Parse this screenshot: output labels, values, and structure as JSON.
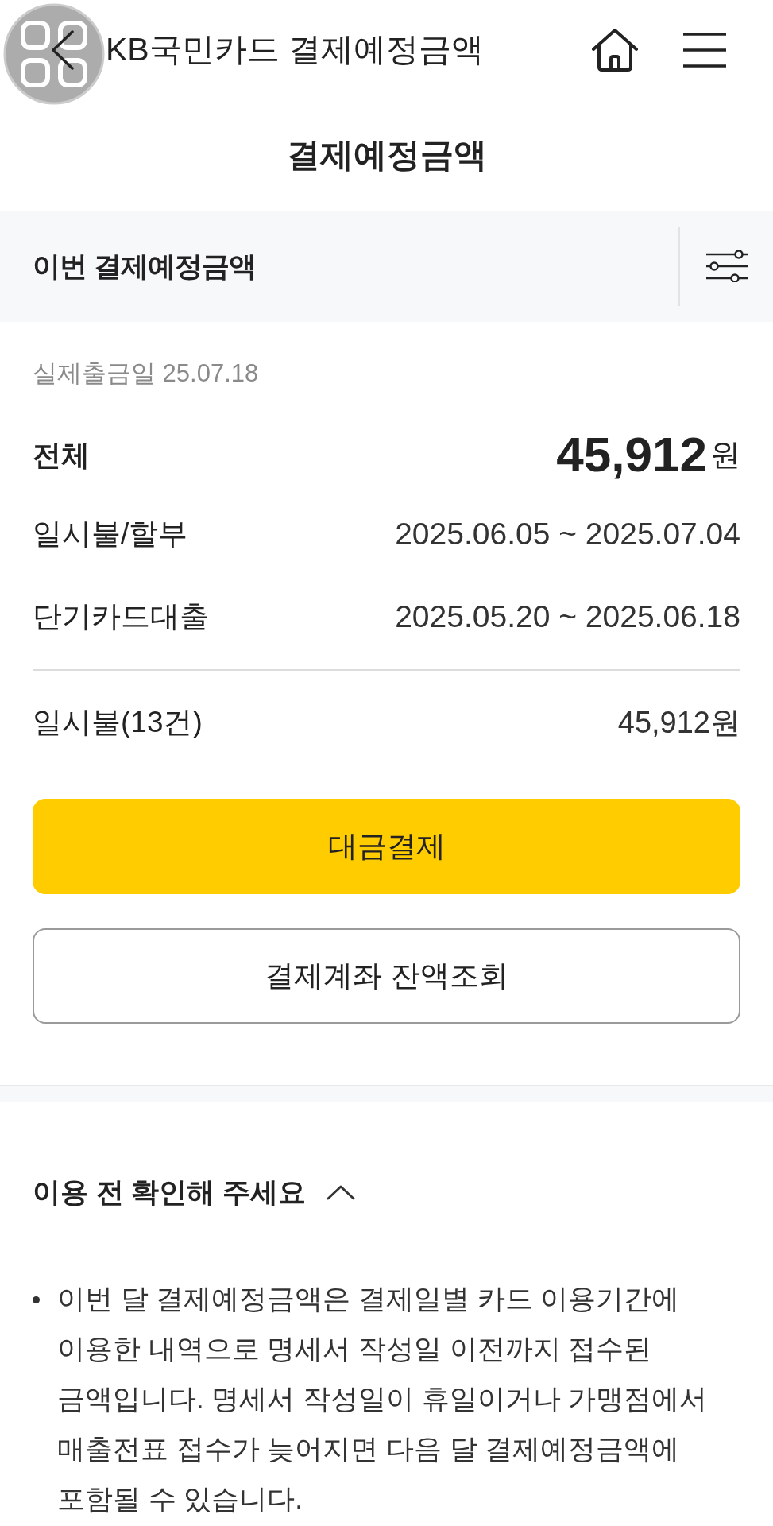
{
  "header": {
    "title": "KB국민카드 결제예정금액"
  },
  "page_title": "결제예정금액",
  "summary_header": {
    "title": "이번 결제예정금액"
  },
  "withdrawal_date": "실제출금일 25.07.18",
  "total": {
    "label": "전체",
    "amount": "45,912",
    "unit": "원"
  },
  "periods": [
    {
      "label": "일시불/할부",
      "value": "2025.06.05 ~ 2025.07.04"
    },
    {
      "label": "단기카드대출",
      "value": "2025.05.20 ~ 2025.06.18"
    }
  ],
  "breakdown": [
    {
      "label": "일시불(13건)",
      "amount": "45,912원"
    }
  ],
  "buttons": [
    {
      "kind": "primary",
      "label": "대금결제"
    },
    {
      "kind": "outline",
      "label": "결제계좌 잔액조회"
    }
  ],
  "notice": {
    "title": "이용 전 확인해 주세요",
    "expanded": true,
    "bullets": [
      "이번 달 결제예정금액은 결제일별 카드 이용기간에 이용한 내역으로 명세서 작성일 이전까지 접수된 금액입니다. 명세서 작성일이 휴일이거나 가맹점에서 매출전표 접수가 늦어지면 다음 달 결제예정금액에 포함될 수 있습니다."
    ]
  }
}
